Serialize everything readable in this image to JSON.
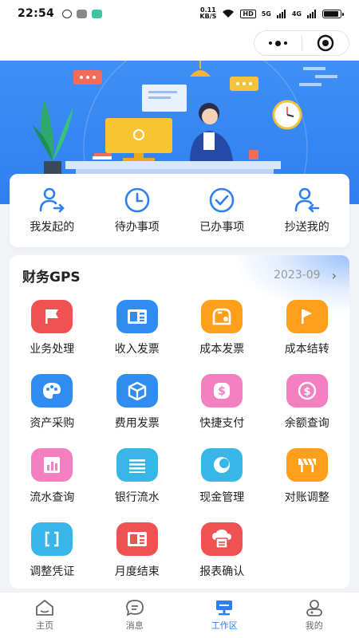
{
  "status_bar": {
    "time": "22:54",
    "net_speed_value": "0.11",
    "net_speed_unit": "KB/S",
    "hd": "HD",
    "sig1": "5G",
    "sig2": "4G"
  },
  "nav": {
    "more_icon": "more-dots-icon",
    "close_icon": "target-icon"
  },
  "quick_actions": [
    {
      "label": "我发起的",
      "icon": "user-send-icon"
    },
    {
      "label": "待办事项",
      "icon": "clock-icon"
    },
    {
      "label": "已办事项",
      "icon": "check-circle-icon"
    },
    {
      "label": "抄送我的",
      "icon": "user-receive-icon"
    }
  ],
  "finance": {
    "title": "财务GPS",
    "date": "2023-09",
    "chevron": "›",
    "items": [
      {
        "label": "业务处理",
        "color": "#f05152",
        "icon": "flag-icon"
      },
      {
        "label": "收入发票",
        "color": "#2f8cf0",
        "icon": "invoice-icon"
      },
      {
        "label": "成本发票",
        "color": "#ff9f1c",
        "icon": "cost-invoice-icon"
      },
      {
        "label": "成本结转",
        "color": "#ff9f1c",
        "icon": "flag-icon"
      },
      {
        "label": "资产采购",
        "color": "#2f8cf0",
        "icon": "palette-icon"
      },
      {
        "label": "费用发票",
        "color": "#2f8cf0",
        "icon": "box-icon"
      },
      {
        "label": "快捷支付",
        "color": "#f47fc1",
        "icon": "dollar-icon"
      },
      {
        "label": "余额查询",
        "color": "#f47fc1",
        "icon": "dollar-icon"
      },
      {
        "label": "流水查询",
        "color": "#f47fc1",
        "icon": "chart-icon"
      },
      {
        "label": "银行流水",
        "color": "#38b6e8",
        "icon": "list-icon"
      },
      {
        "label": "现金管理",
        "color": "#38b6e8",
        "icon": "moon-icon"
      },
      {
        "label": "对账调整",
        "color": "#ff9f1c",
        "icon": "barrier-icon"
      },
      {
        "label": "调整凭证",
        "color": "#38b6e8",
        "icon": "bracket-icon"
      },
      {
        "label": "月度结束",
        "color": "#f05152",
        "icon": "invoice-icon"
      },
      {
        "label": "报表确认",
        "color": "#f05152",
        "icon": "cloud-icon"
      }
    ]
  },
  "tabs": [
    {
      "label": "主页",
      "icon": "home-icon",
      "active": false
    },
    {
      "label": "消息",
      "icon": "message-icon",
      "active": false
    },
    {
      "label": "工作区",
      "icon": "workspace-icon",
      "active": true
    },
    {
      "label": "我的",
      "icon": "profile-icon",
      "active": false
    }
  ],
  "colors": {
    "accent": "#2f7ff0",
    "banner": "#3f8ff5"
  }
}
